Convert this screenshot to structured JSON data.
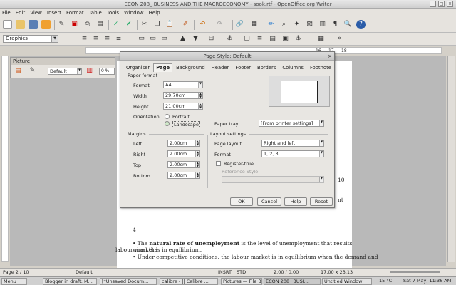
{
  "window": {
    "title": "ECON 208_ BUSINESS AND THE MACROECONOMY - sook.rtf - OpenOffice.org Writer"
  },
  "menu": [
    "File",
    "Edit",
    "View",
    "Insert",
    "Format",
    "Table",
    "Tools",
    "Window",
    "Help"
  ],
  "toolbar": {
    "paragraph_style": "Graphics"
  },
  "picture_panel": {
    "title": "Picture",
    "mode": "Default",
    "percent": "0 %"
  },
  "ruler": {
    "marks": [
      "16",
      "17",
      "18"
    ]
  },
  "dialog": {
    "title": "Page Style: Default",
    "tabs": [
      "Organiser",
      "Page",
      "Background",
      "Header",
      "Footer",
      "Borders",
      "Columns",
      "Footnote"
    ],
    "active_tab": "Page",
    "paper_format": {
      "heading": "Paper format",
      "format_label": "Format",
      "format_value": "A4",
      "width_label": "Width",
      "width_value": "29.70cm",
      "height_label": "Height",
      "height_value": "21.00cm",
      "orientation_label": "Orientation",
      "portrait_label": "Portrait",
      "landscape_label": "Landscape",
      "paper_tray_label": "Paper tray",
      "paper_tray_value": "[From printer settings]"
    },
    "margins": {
      "heading": "Margins",
      "left_label": "Left",
      "left_value": "2.00cm",
      "right_label": "Right",
      "right_value": "2.00cm",
      "top_label": "Top",
      "top_value": "2.00cm",
      "bottom_label": "Bottom",
      "bottom_value": "2.00cm"
    },
    "layout": {
      "heading": "Layout settings",
      "page_layout_label": "Page layout",
      "page_layout_value": "Right and left",
      "format_label": "Format",
      "format_value": "1, 2, 3, ...",
      "register_true_label": "Register-true",
      "reference_style_label": "Reference Style"
    },
    "buttons": {
      "ok": "OK",
      "cancel": "Cancel",
      "help": "Help",
      "reset": "Reset"
    }
  },
  "document": {
    "page_number": "4",
    "bullet1_bold": "natural rate of unemployment",
    "bullet1_pre": "• The ",
    "bullet1_post": " is the level of unemployment that results when the",
    "line2": "labour market is in equilibrium.",
    "bullet2": "• Under competitive conditions, the labour market is in equilibrium when the demand and",
    "side1": "10",
    "side2": "nt"
  },
  "status": {
    "page": "Page 2 / 10",
    "style": "Default",
    "insert": "INSRT",
    "std": "STD",
    "position": "2.00 / 0.00",
    "size": "17.00 x 23.13"
  },
  "taskbar": {
    "menu": "Menu",
    "items": [
      "Blogger in draft: M...",
      "[*Unsaved Docum...",
      "calibre - || Calibre ...",
      "Pictures — File Bro...",
      "ECON 208_ BUSI...",
      "Untitled Window"
    ],
    "temp": "15 °C",
    "clock": "Sat 7 May, 11:36 AM"
  }
}
